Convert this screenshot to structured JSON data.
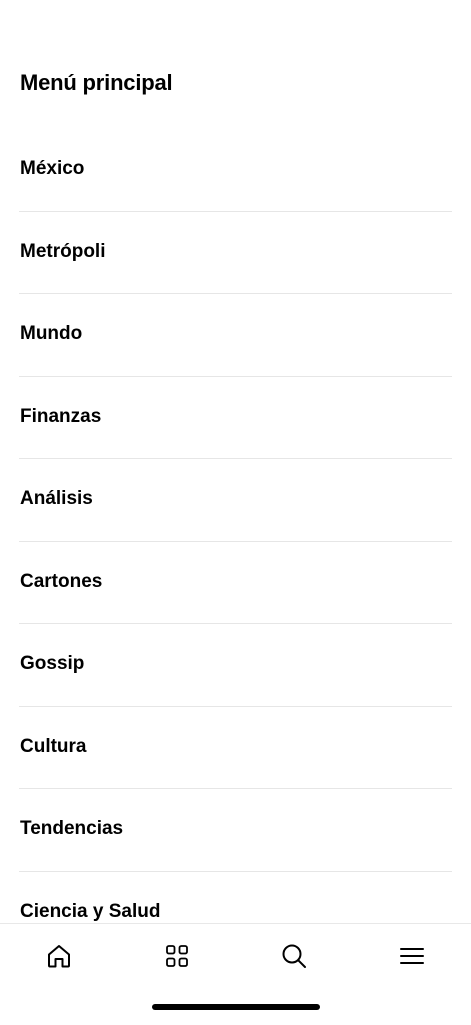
{
  "header": {
    "title": "Menú principal"
  },
  "menu": {
    "items": [
      {
        "label": "México"
      },
      {
        "label": "Metrópoli"
      },
      {
        "label": "Mundo"
      },
      {
        "label": "Finanzas"
      },
      {
        "label": "Análisis"
      },
      {
        "label": "Cartones"
      },
      {
        "label": "Gossip"
      },
      {
        "label": "Cultura"
      },
      {
        "label": "Tendencias"
      },
      {
        "label": "Ciencia y Salud"
      }
    ]
  },
  "tab_bar": {
    "tabs": [
      {
        "icon": "home-icon"
      },
      {
        "icon": "grid-icon"
      },
      {
        "icon": "search-icon"
      },
      {
        "icon": "menu-icon"
      }
    ],
    "icon_color": "#000000",
    "divider_color": "#e6e6e6"
  }
}
